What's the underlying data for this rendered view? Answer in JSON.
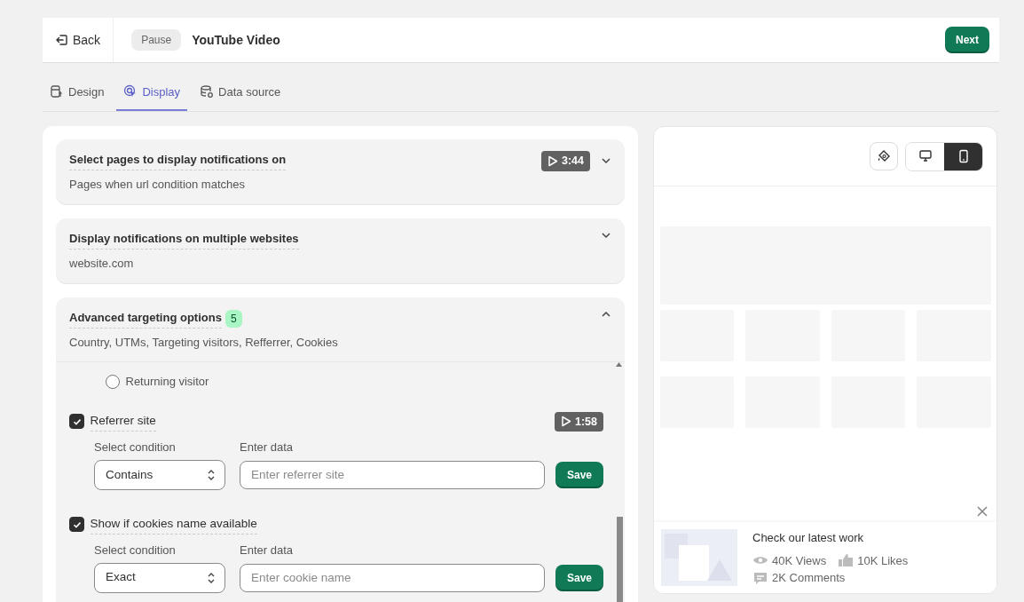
{
  "header": {
    "back": "Back",
    "status": "Pause",
    "title": "YouTube Video",
    "next": "Next"
  },
  "tabs": [
    {
      "label": "Design",
      "selected": false
    },
    {
      "label": "Display",
      "selected": true
    },
    {
      "label": "Data source",
      "selected": false
    }
  ],
  "sections": [
    {
      "title": "Select pages to display notifications on",
      "subtitle": "Pages when url condition matches",
      "video": "3:44",
      "expanded": false
    },
    {
      "title": "Display notifications on multiple websites",
      "subtitle": "website.com",
      "expanded": false
    },
    {
      "title": "Advanced targeting options",
      "badge": "5",
      "subtitle": "Country, UTMs, Targeting visitors, Refferrer, Cookies",
      "expanded": true,
      "radio": {
        "label": "Returning visitor",
        "selected": false
      },
      "conditions": [
        {
          "label": "Referrer site",
          "checked": true,
          "video": "1:58",
          "condition_label": "Select condition",
          "condition_value": "Contains",
          "data_label": "Enter data",
          "placeholder": "Enter referrer site",
          "button": "Save"
        },
        {
          "label": "Show if cookies name available",
          "checked": true,
          "condition_label": "Select condition",
          "condition_value": "Exact",
          "data_label": "Enter data",
          "placeholder": "Enter cookie name",
          "button": "Save"
        }
      ]
    }
  ],
  "preview": {
    "devices": [
      {
        "kind": "desktop",
        "selected": false
      },
      {
        "kind": "mobile",
        "selected": true
      }
    ],
    "notification": {
      "title": "Check our latest work",
      "views": "40K Views",
      "likes": "10K Likes",
      "comments": "2K Comments"
    }
  }
}
